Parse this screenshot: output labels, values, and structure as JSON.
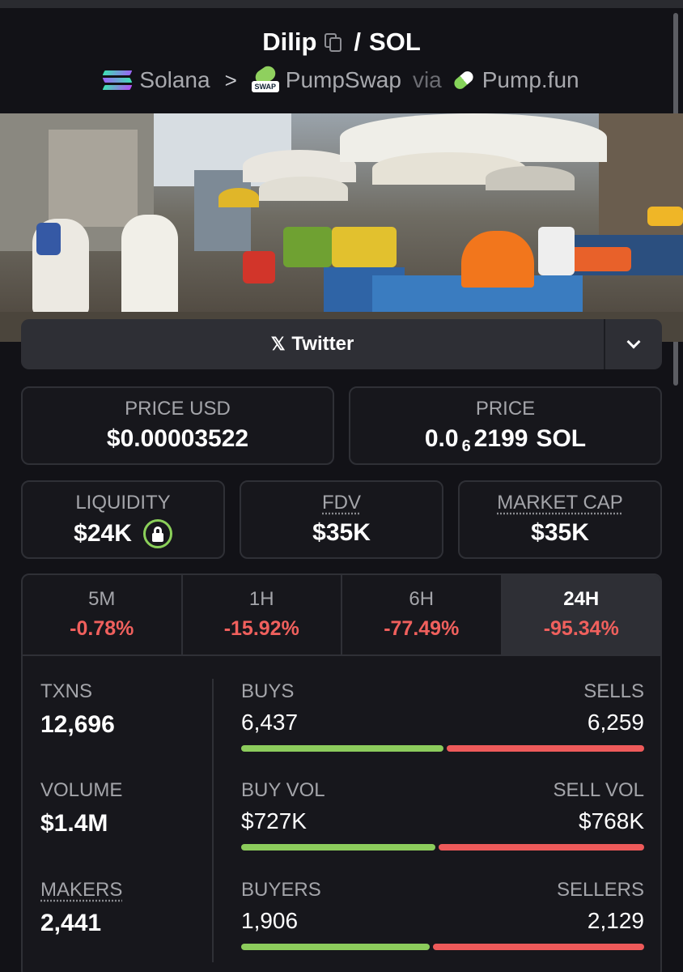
{
  "header": {
    "token": "Dilip",
    "pair": "SOL",
    "separator": "/",
    "chain": "Solana",
    "crumb_sep": ">",
    "dex": "PumpSwap",
    "via": "via",
    "launchpad": "Pump.fun",
    "swap_tag": "SWAP"
  },
  "social": {
    "label": "Twitter",
    "icon": "x-logo"
  },
  "price_usd": {
    "label": "PRICE USD",
    "value": "$0.00003522"
  },
  "price_native": {
    "label": "PRICE",
    "prefix": "0.0",
    "zeros": "6",
    "digits": "2199",
    "unit": "SOL"
  },
  "liquidity": {
    "label": "LIQUIDITY",
    "value": "$24K"
  },
  "fdv": {
    "label": "FDV",
    "value": "$35K"
  },
  "market_cap": {
    "label": "MARKET CAP",
    "value": "$35K"
  },
  "timeframes": [
    {
      "label": "5M",
      "change": "-0.78%"
    },
    {
      "label": "1H",
      "change": "-15.92%"
    },
    {
      "label": "6H",
      "change": "-77.49%"
    },
    {
      "label": "24H",
      "change": "-95.34%"
    }
  ],
  "active_timeframe": "24H",
  "txns": {
    "label": "TXNS",
    "value": "12,696",
    "left_label": "BUYS",
    "left": "6,437",
    "right_label": "SELLS",
    "right": "6,259",
    "left_fraction": 0.507
  },
  "volume": {
    "label": "VOLUME",
    "value": "$1.4M",
    "left_label": "BUY VOL",
    "left": "$727K",
    "right_label": "SELL VOL",
    "right": "$768K",
    "left_fraction": 0.486
  },
  "makers": {
    "label": "MAKERS",
    "value": "2,441",
    "left_label": "BUYERS",
    "left": "1,906",
    "right_label": "SELLERS",
    "right": "2,129",
    "left_fraction": 0.472
  },
  "colors": {
    "up": "#8ccc5c",
    "down": "#ee5a5a",
    "background": "#121217",
    "panel": "#17171c"
  }
}
